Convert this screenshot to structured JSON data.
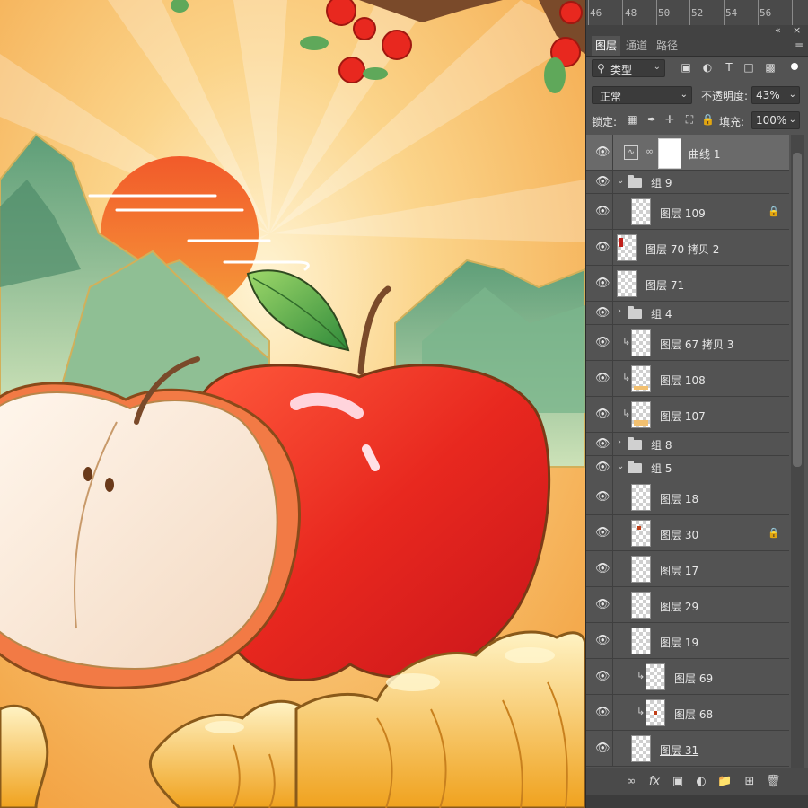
{
  "ruler": {
    "marks": [
      "46",
      "48",
      "50",
      "52",
      "54",
      "56"
    ]
  },
  "window": {
    "collapse_label": "«",
    "close_label": "×"
  },
  "tabs": [
    {
      "label": "图层",
      "active": true
    },
    {
      "label": "通道",
      "active": false
    },
    {
      "label": "路径",
      "active": false
    }
  ],
  "panel_menu_icon": "≡",
  "filter": {
    "kind_label": "类型",
    "icons": [
      "image-filter-icon",
      "adjustment-filter-icon",
      "text-filter-icon",
      "shape-filter-icon",
      "smart-object-filter-icon"
    ]
  },
  "blend_mode": "正常",
  "opacity": {
    "label": "不透明度:",
    "value": "43%"
  },
  "lock": {
    "label": "锁定:"
  },
  "fill": {
    "label": "填充:",
    "value": "100%"
  },
  "layers": [
    {
      "name": "曲线 1",
      "type": "adjustment",
      "selected": true
    },
    {
      "name": "组 9",
      "type": "group",
      "expanded": true
    },
    {
      "name": "图层 109",
      "type": "layer",
      "indent": 1,
      "locked": true
    },
    {
      "name": "图层 70 拷贝 2",
      "type": "layer"
    },
    {
      "name": "图层 71",
      "type": "layer"
    },
    {
      "name": "组 4",
      "type": "group",
      "expanded": false
    },
    {
      "name": "图层 67 拷贝 3",
      "type": "layer",
      "indent": 1,
      "clipped": true
    },
    {
      "name": "图层 108",
      "type": "layer",
      "indent": 1,
      "clipped": true
    },
    {
      "name": "图层 107",
      "type": "layer",
      "indent": 1,
      "clipped": true
    },
    {
      "name": "组 8",
      "type": "group",
      "expanded": false
    },
    {
      "name": "组 5",
      "type": "group",
      "expanded": true
    },
    {
      "name": "图层 18",
      "type": "layer",
      "indent": 1
    },
    {
      "name": "图层 30",
      "type": "layer",
      "indent": 1,
      "locked": true
    },
    {
      "name": "图层 17",
      "type": "layer",
      "indent": 1
    },
    {
      "name": "图层 29",
      "type": "layer",
      "indent": 1
    },
    {
      "name": "图层 19",
      "type": "layer",
      "indent": 1
    },
    {
      "name": "图层 69",
      "type": "layer",
      "indent": 2,
      "clipped": true
    },
    {
      "name": "图层 68",
      "type": "layer",
      "indent": 2,
      "clipped": true
    },
    {
      "name": "图层 31",
      "type": "layer",
      "indent": 1
    }
  ],
  "bottom_icons": [
    "link-icon",
    "fx-icon",
    "mask-icon",
    "adjustment-layer-icon",
    "new-group-icon",
    "new-layer-icon",
    "delete-icon"
  ],
  "fx_label": "fx",
  "colors": {
    "panel_bg": "#535353",
    "selected_row": "#6a6a6a",
    "apple_red": "#e8281f",
    "sky_orange": "#f6b45a",
    "mountain_green": "#6aa882"
  }
}
